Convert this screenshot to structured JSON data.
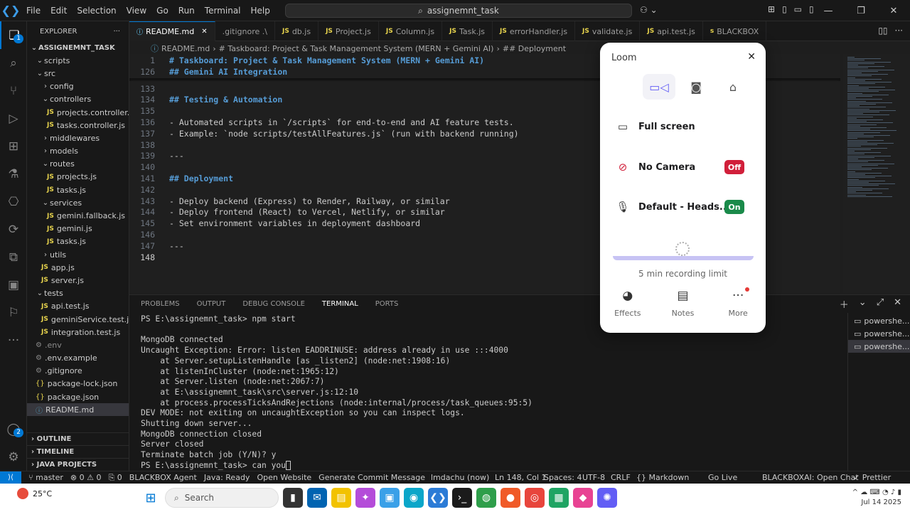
{
  "menu": [
    "File",
    "Edit",
    "Selection",
    "View",
    "Go",
    "Run",
    "Terminal",
    "Help"
  ],
  "search": {
    "text": "assignemnt_task"
  },
  "sidebar": {
    "title": "EXPLORER",
    "root": "ASSIGNEMNT_TASK",
    "items": [
      {
        "label": "scripts",
        "type": "folder",
        "open": true,
        "depth": 1
      },
      {
        "label": "src",
        "type": "folder",
        "open": true,
        "depth": 1
      },
      {
        "label": "config",
        "type": "folder",
        "open": false,
        "depth": 2
      },
      {
        "label": "controllers",
        "type": "folder",
        "open": true,
        "depth": 2
      },
      {
        "label": "projects.controller.js",
        "type": "js",
        "depth": 3
      },
      {
        "label": "tasks.controller.js",
        "type": "js",
        "depth": 3
      },
      {
        "label": "middlewares",
        "type": "folder",
        "open": false,
        "depth": 2
      },
      {
        "label": "models",
        "type": "folder",
        "open": false,
        "depth": 2
      },
      {
        "label": "routes",
        "type": "folder",
        "open": true,
        "depth": 2
      },
      {
        "label": "projects.js",
        "type": "js",
        "depth": 3
      },
      {
        "label": "tasks.js",
        "type": "js",
        "depth": 3
      },
      {
        "label": "services",
        "type": "folder",
        "open": true,
        "depth": 2
      },
      {
        "label": "gemini.fallback.js",
        "type": "js",
        "depth": 3
      },
      {
        "label": "gemini.js",
        "type": "js",
        "depth": 3
      },
      {
        "label": "tasks.js",
        "type": "js",
        "depth": 3
      },
      {
        "label": "utils",
        "type": "folder",
        "open": false,
        "depth": 2
      },
      {
        "label": "app.js",
        "type": "js",
        "depth": 2
      },
      {
        "label": "server.js",
        "type": "js",
        "depth": 2
      },
      {
        "label": "tests",
        "type": "folder",
        "open": true,
        "depth": 1
      },
      {
        "label": "api.test.js",
        "type": "js",
        "depth": 2
      },
      {
        "label": "geminiService.test.js",
        "type": "js",
        "depth": 2
      },
      {
        "label": "integration.test.js",
        "type": "js",
        "depth": 2
      },
      {
        "label": ".env",
        "type": "dotdim",
        "depth": 1
      },
      {
        "label": ".env.example",
        "type": "dot",
        "depth": 1
      },
      {
        "label": ".gitignore",
        "type": "dot",
        "depth": 1
      },
      {
        "label": "package-lock.json",
        "type": "json",
        "depth": 1
      },
      {
        "label": "package.json",
        "type": "json",
        "depth": 1
      },
      {
        "label": "README.md",
        "type": "md",
        "depth": 1,
        "selected": true
      }
    ],
    "sections": [
      "OUTLINE",
      "TIMELINE",
      "JAVA PROJECTS"
    ]
  },
  "tabs": [
    {
      "label": "README.md",
      "icon": "i",
      "active": true
    },
    {
      "label": ".gitignore  .\\",
      "icon": ""
    },
    {
      "label": "db.js",
      "icon": "JS"
    },
    {
      "label": "Project.js",
      "icon": "JS"
    },
    {
      "label": "Column.js",
      "icon": "JS"
    },
    {
      "label": "Task.js",
      "icon": "JS"
    },
    {
      "label": "errorHandler.js",
      "icon": "JS"
    },
    {
      "label": "validate.js",
      "icon": "JS"
    },
    {
      "label": "api.test.js",
      "icon": "JS"
    },
    {
      "label": "BLACKBOX",
      "icon": "s"
    }
  ],
  "breadcrumb": [
    "README.md",
    "# Taskboard: Project & Task Management System (MERN + Gemini AI)",
    "## Deployment"
  ],
  "code": [
    {
      "n": "1",
      "text": "# Taskboard: Project & Task Management System (MERN + Gemini AI)",
      "kind": "h"
    },
    {
      "n": "126",
      "text": "## Gemini AI Integration",
      "kind": "h"
    },
    {
      "n": "133",
      "text": "",
      "kind": "t"
    },
    {
      "n": "134",
      "text": "## Testing & Automation",
      "kind": "h"
    },
    {
      "n": "135",
      "text": "",
      "kind": "t"
    },
    {
      "n": "136",
      "text": "- Automated scripts in `/scripts` for end-to-end and AI feature tests.",
      "kind": "t"
    },
    {
      "n": "137",
      "text": "- Example: `node scripts/testAllFeatures.js` (run with backend running)",
      "kind": "t"
    },
    {
      "n": "138",
      "text": "",
      "kind": "t"
    },
    {
      "n": "139",
      "text": "---",
      "kind": "t"
    },
    {
      "n": "140",
      "text": "",
      "kind": "t"
    },
    {
      "n": "141",
      "text": "## Deployment",
      "kind": "h"
    },
    {
      "n": "142",
      "text": "",
      "kind": "t"
    },
    {
      "n": "143",
      "text": "- Deploy backend (Express) to Render, Railway, or similar",
      "kind": "t"
    },
    {
      "n": "144",
      "text": "- Deploy frontend (React) to Vercel, Netlify, or similar",
      "kind": "t"
    },
    {
      "n": "145",
      "text": "- Set environment variables in deployment dashboard",
      "kind": "t"
    },
    {
      "n": "146",
      "text": "",
      "kind": "t"
    },
    {
      "n": "147",
      "text": "---",
      "kind": "t"
    },
    {
      "n": "148",
      "text": "",
      "kind": "t"
    }
  ],
  "panel": {
    "tabs": [
      "PROBLEMS",
      "OUTPUT",
      "DEBUG CONSOLE",
      "TERMINAL",
      "PORTS"
    ],
    "active": "TERMINAL"
  },
  "terminal": {
    "lines": [
      "PS E:\\assignemnt_task> npm start",
      "",
      "MongoDB connected",
      "Uncaught Exception: Error: listen EADDRINUSE: address already in use :::4000",
      "    at Server.setupListenHandle [as _listen2] (node:net:1908:16)",
      "    at listenInCluster (node:net:1965:12)",
      "    at Server.listen (node:net:2067:7)",
      "    at E:\\assignemnt_task\\src\\server.js:12:10",
      "    at process.processTicksAndRejections (node:internal/process/task_queues:95:5)",
      "DEV MODE: not exiting on uncaughtException so you can inspect logs.",
      "Shutting down server...",
      "MongoDB connection closed",
      "Server closed",
      "Terminate batch job (Y/N)? y",
      "PS E:\\assignemnt_task> can you"
    ],
    "instances": [
      "powershe...",
      "powershe...",
      "powershe..."
    ]
  },
  "statusbar": {
    "branch": "master",
    "problems": "⊗ 0 ⚠ 0",
    "ports": "0",
    "blackbox_agent": "BLACKBOX Agent",
    "java": "Java: Ready",
    "open_website": "Open Website",
    "commit": "Generate Commit Message",
    "user": "lmdachu (now)",
    "position": "Ln 148, Col 1",
    "spaces": "Spaces: 4",
    "encoding": "UTF-8",
    "eol": "CRLF",
    "language": "{} Markdown",
    "golive": "Go Live",
    "blackboxai": "BLACKBOXAI: Open Chat",
    "prettier": "✓ Prettier"
  },
  "taskbar": {
    "temperature": "25°C",
    "search": "Search",
    "date": "Jul 14 2025"
  },
  "loom": {
    "title": "Loom",
    "options": [
      {
        "label": "Full screen",
        "icon": "monitor-icon"
      },
      {
        "label": "No Camera",
        "icon": "camera-off-icon",
        "toggle": "Off"
      },
      {
        "label": "Default - Heads...",
        "icon": "microphone-icon",
        "toggle": "On"
      }
    ],
    "limit": "5 min recording limit",
    "tools": [
      "Effects",
      "Notes",
      "More"
    ],
    "colors": {
      "accent": "#625df5",
      "off": "#d11f3a",
      "on": "#1a8a4a"
    }
  }
}
